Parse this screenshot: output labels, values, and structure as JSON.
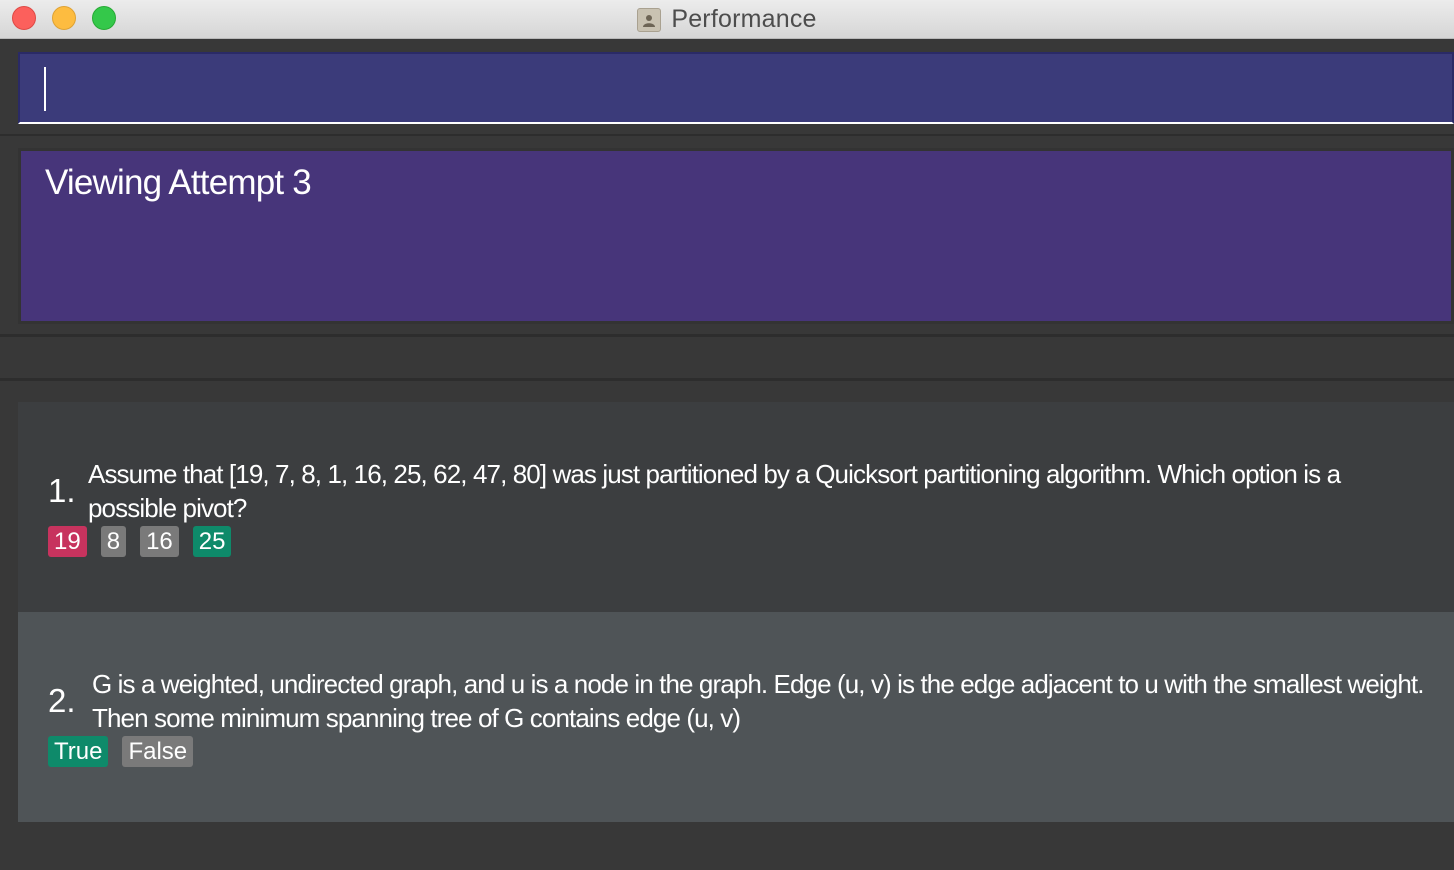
{
  "window": {
    "title": "Performance"
  },
  "command_box": {
    "value": ""
  },
  "result_display": {
    "text": "Viewing Attempt 3"
  },
  "colors": {
    "command_bg": "#3b3b7a",
    "result_bg": "#47357a",
    "option_wrong": "#c7335e",
    "option_neutral": "#7a7a7a",
    "option_correct": "#0e8a6a"
  },
  "questions": [
    {
      "number": "1.",
      "text": "Assume that [19, 7, 8, 1, 16, 25, 62, 47, 80] was just partitioned by a Quicksort partitioning algorithm. Which option is a possible pivot?",
      "options": [
        {
          "label": "19",
          "status": "wrong"
        },
        {
          "label": "8",
          "status": "neutral"
        },
        {
          "label": "16",
          "status": "neutral"
        },
        {
          "label": "25",
          "status": "correct"
        }
      ]
    },
    {
      "number": "2.",
      "text": "G is a weighted, undirected graph, and u is a node in the graph. Edge (u, v) is the edge adjacent to u with the smallest weight. Then some minimum spanning tree of G contains edge (u, v)",
      "options": [
        {
          "label": "True",
          "status": "correct"
        },
        {
          "label": "False",
          "status": "neutral"
        }
      ]
    }
  ]
}
